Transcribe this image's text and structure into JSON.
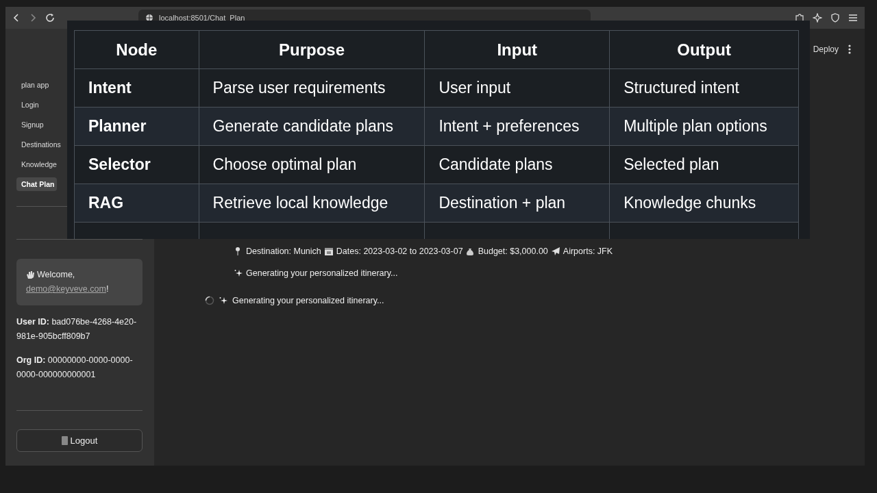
{
  "browser": {
    "url": "localhost:8501/Chat_Plan"
  },
  "header": {
    "deploy": "Deploy"
  },
  "sidebar": {
    "nav": [
      {
        "label": "plan app",
        "selected": false
      },
      {
        "label": "Login",
        "selected": false
      },
      {
        "label": "Signup",
        "selected": false
      },
      {
        "label": "Destinations",
        "selected": false
      },
      {
        "label": "Knowledge",
        "selected": false
      },
      {
        "label": "Chat Plan",
        "selected": true
      }
    ],
    "welcome": {
      "greeting": "Welcome,",
      "email": "demo@keyveve.com",
      "end": "!"
    },
    "user_id": "**User ID:** bad076be-4268-4e20-981e-905bcff809b7",
    "org_id": "**Org ID:** 00000000-0000-0000-0000-000000000001",
    "logout": "Logout"
  },
  "main": {
    "summary": [
      {
        "kind": "pin",
        "text": "Destination: Munich"
      },
      {
        "kind": "calendar",
        "text": "Dates: 2023-03-02 to 2023-03-07"
      },
      {
        "kind": "money",
        "text": "Budget: $3,000.00"
      },
      {
        "kind": "plane",
        "text": "Airports: JFK"
      }
    ],
    "status": "Generating your personalized itinerary...",
    "spinner_status": "Generating your personalized itinerary..."
  },
  "table": {
    "columns": [
      "Node",
      "Purpose",
      "Input",
      "Output"
    ],
    "rows": [
      [
        "Intent",
        "Parse user requirements",
        "User input",
        "Structured intent"
      ],
      [
        "Planner",
        "Generate candidate plans",
        "Intent + preferences",
        "Multiple plan options"
      ],
      [
        "Selector",
        "Choose optimal plan",
        "Candidate plans",
        "Selected plan"
      ],
      [
        "RAG",
        "Retrieve local knowledge",
        "Destination + plan",
        "Knowledge chunks"
      ]
    ]
  }
}
